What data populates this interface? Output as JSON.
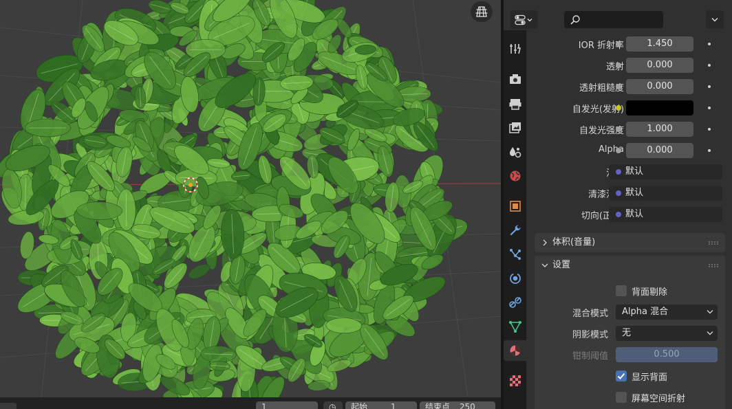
{
  "viewport": {
    "bottom_fields": [
      "1",
      "起始",
      "1",
      "结束点",
      "250"
    ]
  },
  "header": {
    "search": {
      "value": "",
      "placeholder": ""
    }
  },
  "tabs": [
    {
      "name": "tool-tab",
      "icon": "tool-icon"
    },
    {
      "name": "render-tab",
      "icon": "render-icon"
    },
    {
      "name": "output-tab",
      "icon": "output-icon"
    },
    {
      "name": "view-layer-tab",
      "icon": "view-layer-icon"
    },
    {
      "name": "scene-tab",
      "icon": "scene-icon"
    },
    {
      "name": "world-tab",
      "icon": "world-icon"
    },
    {
      "name": "object-tab",
      "icon": "object-icon"
    },
    {
      "name": "modifier-tab",
      "icon": "wrench-icon"
    },
    {
      "name": "particles-tab",
      "icon": "particles-icon"
    },
    {
      "name": "physics-tab",
      "icon": "physics-icon"
    },
    {
      "name": "constraints-tab",
      "icon": "constraint-icon"
    },
    {
      "name": "data-tab",
      "icon": "mesh-data-icon"
    },
    {
      "name": "material-tab",
      "icon": "material-icon",
      "active": true
    },
    {
      "name": "texture-tab",
      "icon": "texture-icon"
    }
  ],
  "inputs": [
    {
      "label": "IOR 折射率",
      "value": "1.450",
      "socket": "#a1a1a1",
      "kind": "num"
    },
    {
      "label": "透射",
      "value": "0.000",
      "socket": "#a1a1a1",
      "kind": "num"
    },
    {
      "label": "透射粗糙度",
      "value": "0.000",
      "socket": "#a1a1a1",
      "kind": "num"
    },
    {
      "label": "自发光(发射)",
      "value": "",
      "socket": "#c7c729",
      "kind": "color",
      "color": "#000000"
    },
    {
      "label": "自发光强度",
      "value": "1.000",
      "socket": "#a1a1a1",
      "kind": "num"
    },
    {
      "label": "Alpha",
      "value": "0.000",
      "socket": "#a1a1a1",
      "kind": "num"
    },
    {
      "label": "法向",
      "value": "默认",
      "socket": "#6363c7",
      "kind": "link"
    },
    {
      "label": "清漆法线",
      "value": "默认",
      "socket": "#6363c7",
      "kind": "link"
    },
    {
      "label": "切向(正切)",
      "value": "默认",
      "socket": "#6363c7",
      "kind": "link"
    }
  ],
  "panels": {
    "volume": {
      "title": "体积(音量)",
      "expanded": false
    },
    "settings": {
      "title": "设置",
      "expanded": true
    }
  },
  "settings": {
    "backface_culling": {
      "label": "背面剔除",
      "checked": false
    },
    "blend_mode": {
      "label": "混合模式",
      "value": "Alpha 混合"
    },
    "shadow_mode": {
      "label": "阴影模式",
      "value": "无"
    },
    "clip_threshold": {
      "label": "钳制阈值",
      "value": "0.500",
      "fraction": 0.5
    },
    "show_backface": {
      "label": "显示背面",
      "checked": true
    },
    "screen_space_refraction": {
      "label": "屏幕空间折射",
      "checked": false
    }
  },
  "colors": {
    "accent": "#4772b3",
    "panel_bg": "#303030",
    "field_bg": "#545454",
    "leaf_dark": "#2f6b22",
    "leaf_light": "#7bc04a"
  }
}
